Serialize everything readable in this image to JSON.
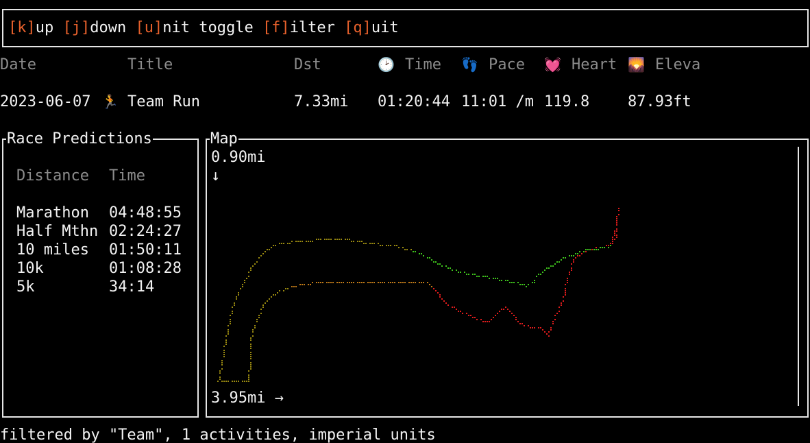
{
  "help": {
    "items": [
      {
        "key": "[k]",
        "rest": "up "
      },
      {
        "key": "[j]",
        "rest": "down "
      },
      {
        "key": "[u]",
        "rest": "nit toggle "
      },
      {
        "key": "[f]",
        "rest": "ilter "
      },
      {
        "key": "[q]",
        "rest": "uit"
      }
    ]
  },
  "table": {
    "headers": {
      "date": "Date",
      "title": "Title",
      "dst": "Dst",
      "time": "Time",
      "pace": "Pace",
      "heart": "Heart",
      "elev": "Eleva"
    },
    "header_icons": {
      "time": "🕑",
      "pace": "👣",
      "heart": "💓",
      "elev": "🌄"
    },
    "rows": [
      {
        "date": "2023-06-07",
        "icon": "🏃",
        "title": "Team Run",
        "dst": "7.33mi",
        "time": "01:20:44",
        "pace": "11:01 /m",
        "heart": "119.8",
        "elev": "87.93ft"
      }
    ]
  },
  "race": {
    "title": "Race Predictions",
    "col_distance": "Distance",
    "col_time": "Time",
    "rows": [
      {
        "distance": "Marathon",
        "time": "04:48:55"
      },
      {
        "distance": "Half Mthn",
        "time": "02:24:27"
      },
      {
        "distance": "10 miles",
        "time": "01:50:11"
      },
      {
        "distance": "10k",
        "time": "01:08:28"
      },
      {
        "distance": "5k",
        "time": "34:14"
      }
    ]
  },
  "map": {
    "title": "Map",
    "y_label": "0.90mi",
    "y_arrow": "↓",
    "x_label": "3.95mi →",
    "colors": {
      "start": "#9a8a10",
      "mid": "#c07a18",
      "green": "#3fc51c",
      "red": "#e01c1c"
    }
  },
  "status": "filtered by \"Team\", 1 activities, imperial units"
}
